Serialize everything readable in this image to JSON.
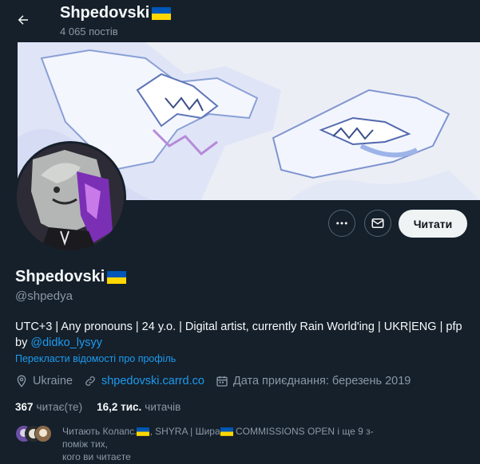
{
  "header": {
    "back_icon": "arrow-left-icon",
    "title": "Shpedovski",
    "posts": "4 065 постів"
  },
  "colors": {
    "background": "#15202b",
    "accent": "#1d9bf0",
    "muted": "#8b98a5",
    "flag_blue": "#0057b7",
    "flag_yellow": "#ffd700"
  },
  "actions": {
    "more_icon": "more-icon",
    "message_icon": "mail-icon",
    "follow_label": "Читати"
  },
  "profile": {
    "name": "Shpedovski",
    "handle": "@shpedya",
    "bio_text": "UTC+3 | Any pronouns | 24 y.o. | Digital artist, currently Rain World'ing | UKR|ENG | pfp by ",
    "bio_link": "@didko_lysyy",
    "translate": "Перекласти відомості про профіль",
    "location": "Ukraine",
    "website": "shpedovski.carrd.co",
    "joined": "Дата приєднання: березень 2019"
  },
  "stats": {
    "following_count": "367",
    "following_label": "читає(те)",
    "followers_count": "16,2 тис.",
    "followers_label": "читачів"
  },
  "followed_by": {
    "line1_a": "Читають Колапс.",
    "line1_b": ", SHYRA | Шира",
    "line1_c": " COMMISSIONS OPEN і ще 9 з-поміж тих,",
    "line2": "кого ви читаєте"
  }
}
